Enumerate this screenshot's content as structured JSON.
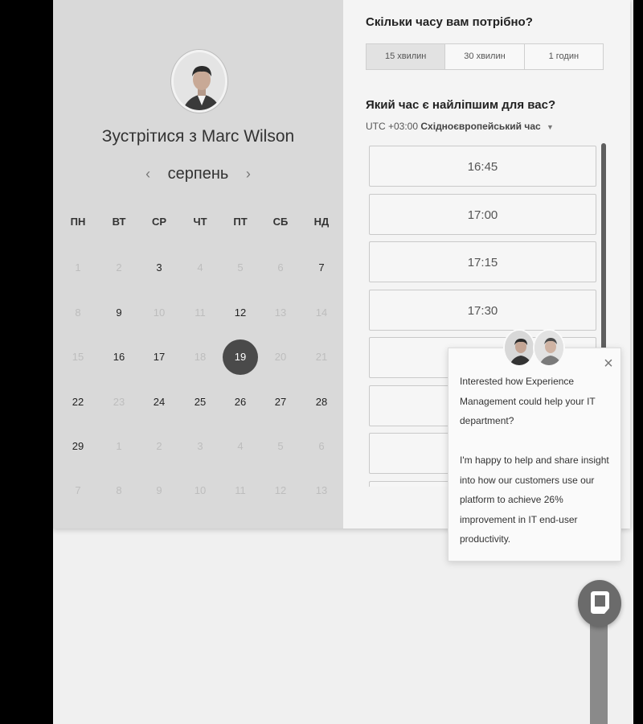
{
  "meeting": {
    "title": "Зустрітися з Marc Wilson",
    "host_avatar": "host-portrait"
  },
  "calendar": {
    "month": "серпень",
    "prev_icon": "‹",
    "next_icon": "›",
    "weekdays": [
      "ПН",
      "ВТ",
      "СР",
      "ЧТ",
      "ПТ",
      "СБ",
      "НД"
    ],
    "weeks": [
      [
        {
          "d": "1",
          "m": true
        },
        {
          "d": "2",
          "m": true
        },
        {
          "d": "3",
          "m": false
        },
        {
          "d": "4",
          "m": true
        },
        {
          "d": "5",
          "m": true
        },
        {
          "d": "6",
          "m": true
        },
        {
          "d": "7",
          "m": false
        }
      ],
      [
        {
          "d": "8",
          "m": true
        },
        {
          "d": "9",
          "m": false
        },
        {
          "d": "10",
          "m": true
        },
        {
          "d": "11",
          "m": true
        },
        {
          "d": "12",
          "m": false
        },
        {
          "d": "13",
          "m": true
        },
        {
          "d": "14",
          "m": true
        }
      ],
      [
        {
          "d": "15",
          "m": true
        },
        {
          "d": "16",
          "m": false
        },
        {
          "d": "17",
          "m": false
        },
        {
          "d": "18",
          "m": true
        },
        {
          "d": "19",
          "m": false,
          "sel": true
        },
        {
          "d": "20",
          "m": true
        },
        {
          "d": "21",
          "m": true
        }
      ],
      [
        {
          "d": "22",
          "m": false
        },
        {
          "d": "23",
          "m": true
        },
        {
          "d": "24",
          "m": false
        },
        {
          "d": "25",
          "m": false
        },
        {
          "d": "26",
          "m": false
        },
        {
          "d": "27",
          "m": false
        },
        {
          "d": "28",
          "m": false
        }
      ],
      [
        {
          "d": "29",
          "m": false
        },
        {
          "d": "1",
          "m": true
        },
        {
          "d": "2",
          "m": true
        },
        {
          "d": "3",
          "m": true
        },
        {
          "d": "4",
          "m": true
        },
        {
          "d": "5",
          "m": true
        },
        {
          "d": "6",
          "m": true
        }
      ],
      [
        {
          "d": "7",
          "m": true
        },
        {
          "d": "8",
          "m": true
        },
        {
          "d": "9",
          "m": true
        },
        {
          "d": "10",
          "m": true
        },
        {
          "d": "11",
          "m": true
        },
        {
          "d": "12",
          "m": true
        },
        {
          "d": "13",
          "m": true
        }
      ]
    ]
  },
  "duration": {
    "question": "Скільки часу вам потрібно?",
    "options": [
      "15 хвилин",
      "30 хвилин",
      "1 годин"
    ],
    "selected_index": 0
  },
  "time": {
    "question": "Який час є найліпшим для вас?",
    "timezone_offset": "UTC +03:00",
    "timezone_name": "Східноєвропейський час",
    "caret_icon": "▼",
    "slots": [
      "16:45",
      "17:00",
      "17:15",
      "17:30",
      "",
      "",
      "",
      ""
    ]
  },
  "chat_popup": {
    "close_icon": "×",
    "message_1": "Interested how Experience Management could help your IT department?",
    "message_2": "I'm happy to help and share insight into how our customers use our platform to achieve 26% improvement in IT end-user productivity.",
    "agent_avatars": [
      "agent-avatar-1",
      "agent-avatar-2"
    ]
  },
  "chat_launcher": {
    "icon": "chat-bubble-icon"
  }
}
